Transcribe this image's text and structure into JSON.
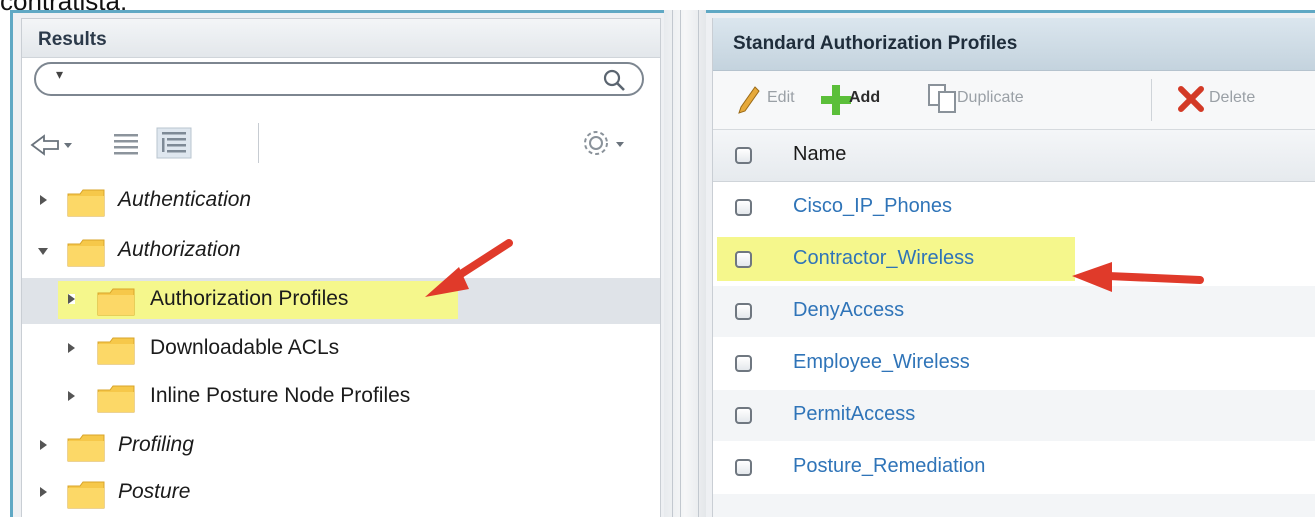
{
  "cut_text": "contratista:",
  "left_panel": {
    "title": "Results",
    "search": {
      "value": "",
      "placeholder": ""
    },
    "tree": [
      {
        "label": "Authentication",
        "italic": true,
        "expanded": false,
        "level": 0
      },
      {
        "label": "Authorization",
        "italic": true,
        "expanded": true,
        "level": 0
      },
      {
        "label": "Authorization Profiles",
        "italic": false,
        "expanded": false,
        "level": 1,
        "selected": true
      },
      {
        "label": "Downloadable ACLs",
        "italic": false,
        "expanded": false,
        "level": 1
      },
      {
        "label": "Inline Posture Node Profiles",
        "italic": false,
        "expanded": false,
        "level": 1
      },
      {
        "label": "Profiling",
        "italic": true,
        "expanded": false,
        "level": 0
      },
      {
        "label": "Posture",
        "italic": true,
        "expanded": false,
        "level": 0
      }
    ]
  },
  "right_panel": {
    "title": "Standard Authorization Profiles",
    "toolbar": {
      "edit": "Edit",
      "add": "Add",
      "duplicate": "Duplicate",
      "delete": "Delete"
    },
    "column_header": "Name",
    "rows": [
      "Cisco_IP_Phones",
      "Contractor_Wireless",
      "DenyAccess",
      "Employee_Wireless",
      "PermitAccess",
      "Posture_Remediation"
    ],
    "highlighted_row": "Contractor_Wireless"
  },
  "colors": {
    "highlight": "#f5f78c",
    "link": "#2f74b8",
    "annotation_arrow": "#e03a2a",
    "frame": "#5fa8c4"
  }
}
